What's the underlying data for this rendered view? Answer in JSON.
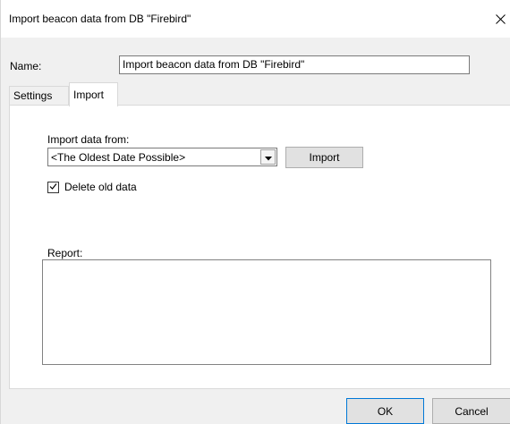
{
  "window": {
    "title": "Import beacon data from DB \"Firebird\""
  },
  "name_field": {
    "label": "Name:",
    "value": "Import beacon data from DB \"Firebird\""
  },
  "tabs": [
    {
      "label": "Settings",
      "active": false
    },
    {
      "label": "Import",
      "active": true
    }
  ],
  "import_tab": {
    "import_from_label": "Import data from:",
    "import_from_value": "<The Oldest Date Possible>",
    "import_button": "Import",
    "delete_old_data": {
      "label": "Delete old data",
      "checked": true
    },
    "report_label": "Report:",
    "report_text": ""
  },
  "footer": {
    "ok": "OK",
    "cancel": "Cancel"
  },
  "icons": {
    "close": "close-icon",
    "dropdown": "chevron-down-icon",
    "check": "check-icon"
  }
}
